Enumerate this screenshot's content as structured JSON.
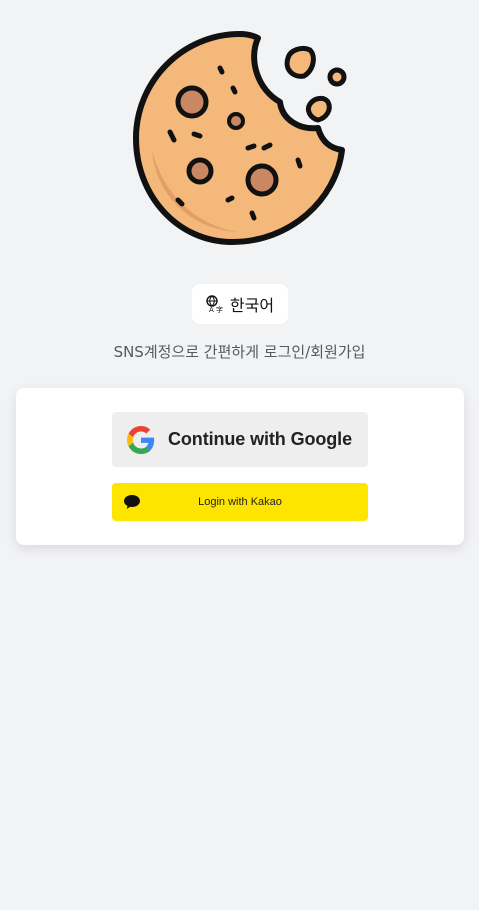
{
  "logo": {
    "icon": "cookie-logo-icon"
  },
  "language": {
    "icon": "translate-icon",
    "label": "한국어"
  },
  "subtitle": "SNS계정으로 간편하게 로그인/회원가입",
  "login": {
    "google": {
      "icon": "google-icon",
      "label": "Continue with Google"
    },
    "kakao": {
      "icon": "kakao-chat-bubble-icon",
      "label": "Login with Kakao"
    }
  },
  "colors": {
    "background": "#f2f3f5",
    "cookie": "#f4b87a",
    "cookie_shadow": "#e0a068",
    "chip": "#c98863",
    "kakao": "#fee500",
    "google_button": "#eeeeee"
  }
}
